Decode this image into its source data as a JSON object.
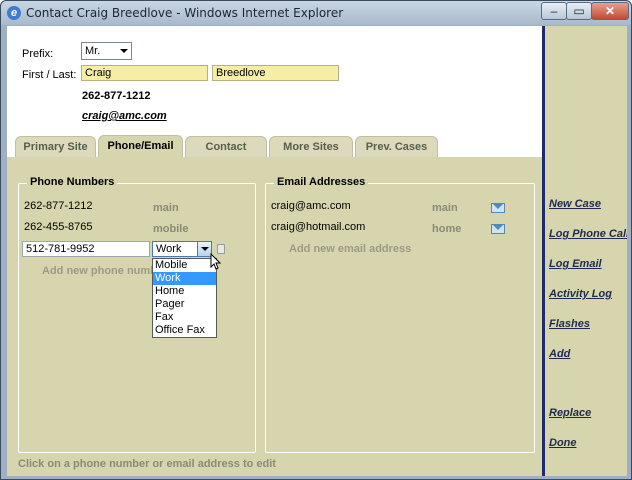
{
  "window": {
    "title": "Contact Craig Breedlove - Windows Internet Explorer",
    "minimize": "–",
    "maximize": "▭",
    "close": "✕"
  },
  "header": {
    "prefix_label": "Prefix:",
    "prefix_value": "Mr.",
    "name_label": "First / Last:",
    "first_name": "Craig",
    "last_name": "Breedlove",
    "phone": "262-877-1212",
    "email": "craig@amc.com"
  },
  "tabs": [
    {
      "label": "Primary Site",
      "active": false
    },
    {
      "label": "Phone/Email",
      "active": true
    },
    {
      "label": "Contact",
      "active": false
    },
    {
      "label": "More Sites",
      "active": false
    },
    {
      "label": "Prev. Cases",
      "active": false
    }
  ],
  "phones": {
    "title": "Phone Numbers",
    "rows": [
      {
        "number": "262-877-1212",
        "type": "main"
      },
      {
        "number": "262-455-8765",
        "type": "mobile"
      }
    ],
    "editing_number": "512-781-9952",
    "editing_type": "Work",
    "add_label": "Add new phone number",
    "type_options": [
      "Mobile",
      "Work",
      "Home",
      "Pager",
      "Fax",
      "Office Fax"
    ],
    "selected_option": "Work"
  },
  "emails": {
    "title": "Email Addresses",
    "rows": [
      {
        "address": "craig@amc.com",
        "type": "main"
      },
      {
        "address": "craig@hotmail.com",
        "type": "home"
      }
    ],
    "add_label": "Add new email address"
  },
  "hint": "Click on a phone number or email address to edit",
  "sidebar": {
    "links": [
      "New Case",
      "Log Phone Call",
      "Log Email",
      "Activity Log",
      "Flashes",
      "Add",
      "Replace",
      "Done"
    ]
  }
}
